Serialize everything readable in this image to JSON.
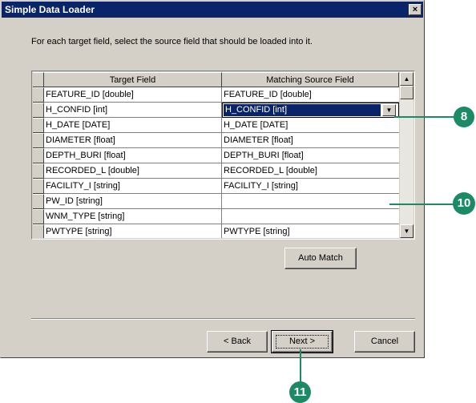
{
  "window": {
    "title": "Simple Data Loader",
    "close_label": "×"
  },
  "instruction": "For each target field, select the source field that should be loaded into it.",
  "grid": {
    "headers": {
      "target": "Target Field",
      "source": "Matching Source Field"
    },
    "rows": [
      {
        "target": "FEATURE_ID [double]",
        "source": "FEATURE_ID [double]"
      },
      {
        "target": "H_CONFID [int]",
        "source": "H_CONFID [int]"
      },
      {
        "target": "H_DATE [DATE]",
        "source": "H_DATE [DATE]"
      },
      {
        "target": "DIAMETER [float]",
        "source": "DIAMETER [float]"
      },
      {
        "target": "DEPTH_BURI [float]",
        "source": "DEPTH_BURI [float]"
      },
      {
        "target": "RECORDED_L [double]",
        "source": "RECORDED_L [double]"
      },
      {
        "target": "FACILITY_I [string]",
        "source": "FACILITY_I [string]"
      },
      {
        "target": "PW_ID [string]",
        "source": ""
      },
      {
        "target": "WNM_TYPE [string]",
        "source": ""
      },
      {
        "target": "PWTYPE [string]",
        "source": "PWTYPE [string]"
      }
    ]
  },
  "buttons": {
    "auto_match": "Auto Match",
    "back": "< Back",
    "next": "Next >",
    "cancel": "Cancel"
  },
  "callouts": {
    "c8": "8",
    "c10": "10",
    "c11": "11"
  },
  "colors": {
    "selection": "#0a246a",
    "callout": "#1d8a66",
    "dialog_bg": "#d4d0c8"
  },
  "icons": {
    "scroll_up": "▲",
    "scroll_down": "▼",
    "dropdown": "▼"
  }
}
